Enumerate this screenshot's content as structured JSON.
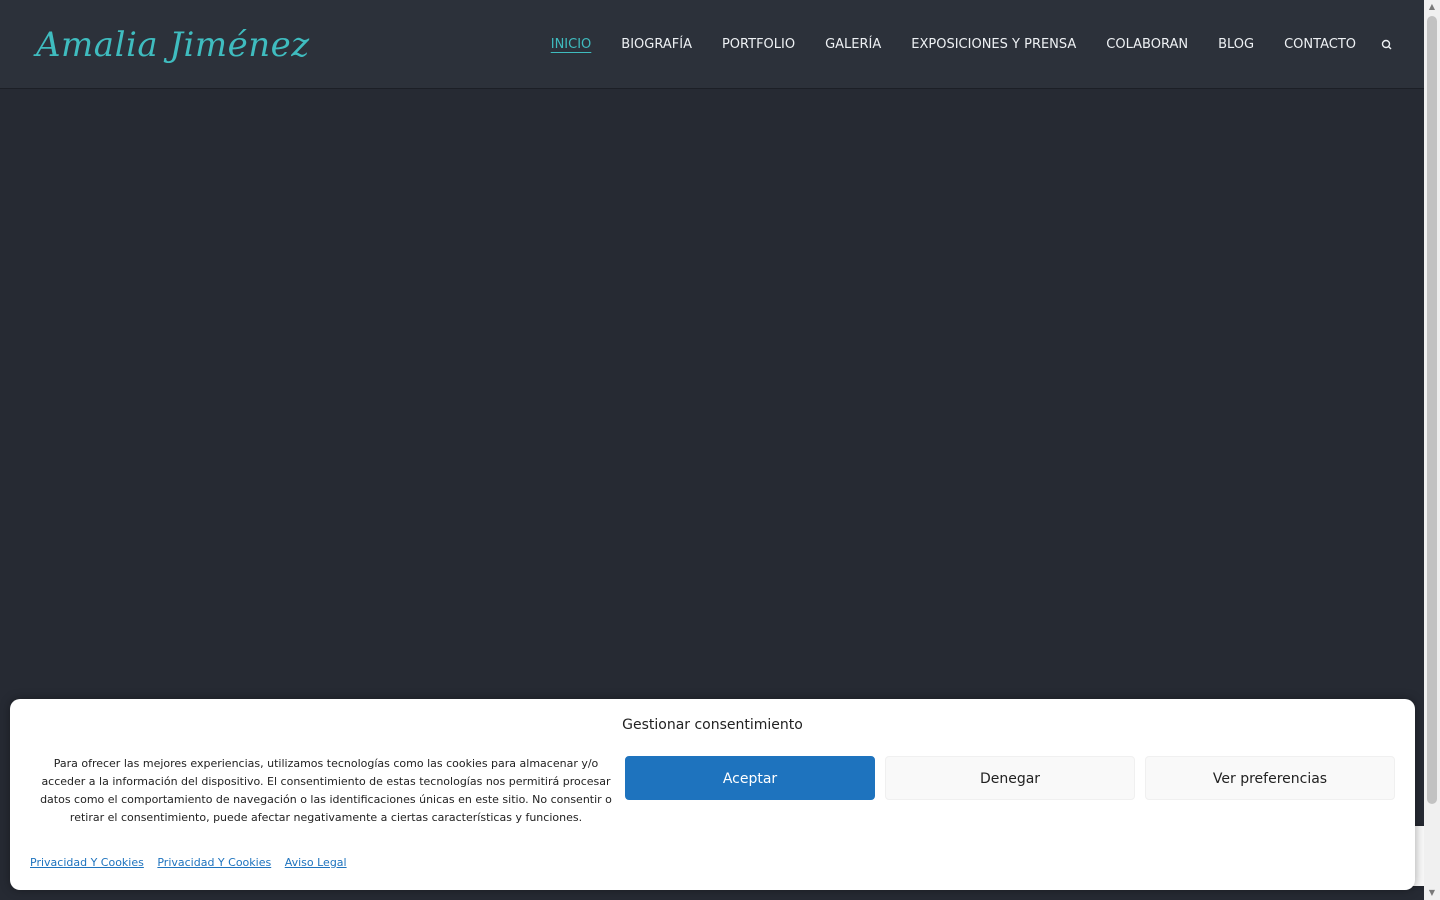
{
  "brand": {
    "name": "Amalia Jiménez",
    "accent_color": "#3fbcbf"
  },
  "nav": {
    "items": [
      {
        "label": "INICIO",
        "active": true
      },
      {
        "label": "BIOGRAFÍA"
      },
      {
        "label": "PORTFOLIO"
      },
      {
        "label": "GALERÍA"
      },
      {
        "label": "EXPOSICIONES Y PRENSA"
      },
      {
        "label": "COLABORAN"
      },
      {
        "label": "BLOG"
      },
      {
        "label": "CONTACTO"
      }
    ],
    "search_icon": "search-icon"
  },
  "cookie": {
    "title": "Gestionar consentimiento",
    "message": "Para ofrecer las mejores experiencias, utilizamos tecnologías como las cookies para almacenar y/o acceder a la información del dispositivo. El consentimiento de estas tecnologías nos permitirá procesar datos como el comportamiento de navegación o las identificaciones únicas en este sitio. No consentir o retirar el consentimiento, puede afectar negativamente a ciertas características y funciones.",
    "accept_label": "Aceptar",
    "deny_label": "Denegar",
    "prefs_label": "Ver preferencias",
    "links": [
      "Privacidad Y Cookies",
      "Privacidad Y Cookies",
      "Aviso Legal"
    ],
    "accent_color": "#1e73be"
  }
}
